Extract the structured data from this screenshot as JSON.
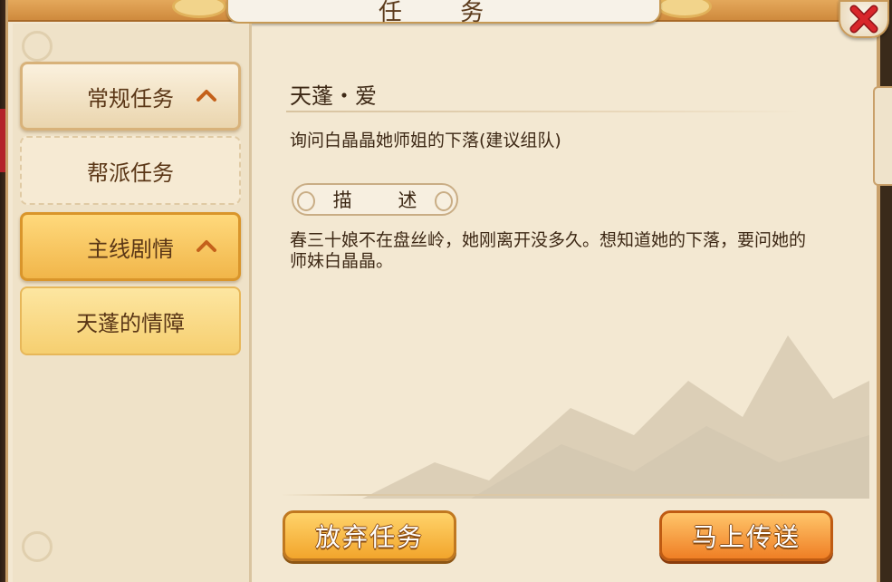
{
  "window": {
    "title": "任 务",
    "close_icon": "close-x-icon"
  },
  "sidebar": {
    "items": [
      {
        "label": "常规任务",
        "kind": "category",
        "expanded": true,
        "active": false
      },
      {
        "label": "帮派任务",
        "kind": "subitem",
        "active": false
      },
      {
        "label": "主线剧情",
        "kind": "category",
        "expanded": true,
        "active": true
      },
      {
        "label": "天蓬的情障",
        "kind": "subitem",
        "active": true
      }
    ]
  },
  "quest": {
    "title": "天蓬・爱",
    "goal": "询问白晶晶她师姐的下落(建议组队)",
    "description_label": "描 述",
    "description": "春三十娘不在盘丝岭，她刚离开没多久。想知道她的下落，要问她的师妹白晶晶。"
  },
  "actions": {
    "abandon_label": "放弃任务",
    "teleport_label": "马上传送"
  },
  "colors": {
    "panel_bg": "#f3e8d2",
    "accent_gold": "#f1b64a",
    "accent_orange": "#ef7f25",
    "close_red": "#d8262b",
    "text_brown": "#3d2815"
  }
}
